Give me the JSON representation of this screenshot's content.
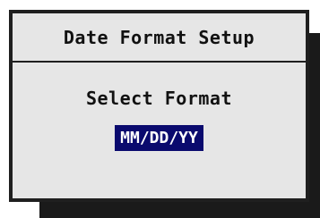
{
  "dialog": {
    "title": "Date Format Setup",
    "prompt": "Select Format",
    "selected_value": "MM/DD/YY"
  },
  "colors": {
    "panel_background": "#e6e6e6",
    "border": "#1f1f1f",
    "shadow": "#1a1a1a",
    "highlight_background": "#0a0a6e",
    "highlight_text": "#ffffff",
    "text": "#111111"
  }
}
